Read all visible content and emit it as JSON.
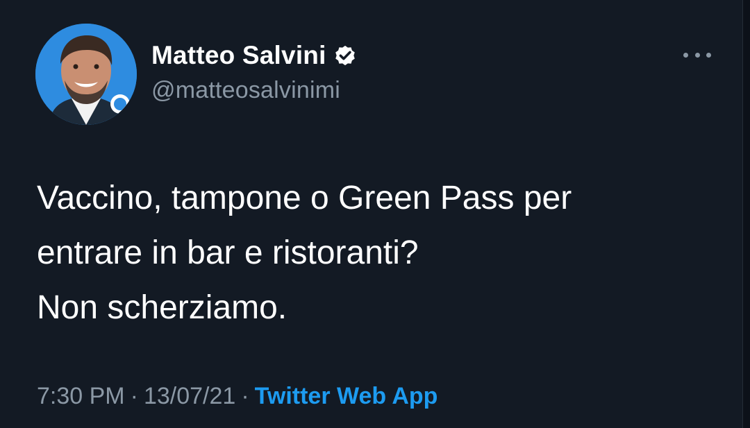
{
  "author": {
    "display_name": "Matteo Salvini",
    "handle": "@matteosalvinimi",
    "verified": true,
    "avatar_icon": "profile-photo"
  },
  "tweet": {
    "lines": [
      "Vaccino, tampone o Green Pass per",
      "entrare in bar e ristoranti?",
      "Non scherziamo."
    ]
  },
  "meta": {
    "time": "7:30 PM",
    "separator": "·",
    "date": "13/07/21",
    "source": "Twitter Web App"
  },
  "icons": {
    "more": "more-options-icon",
    "verified": "verified-badge-icon"
  },
  "colors": {
    "background": "#131a24",
    "text": "#ffffff",
    "secondary_text": "#8b98a5",
    "link": "#1d9bf0"
  }
}
